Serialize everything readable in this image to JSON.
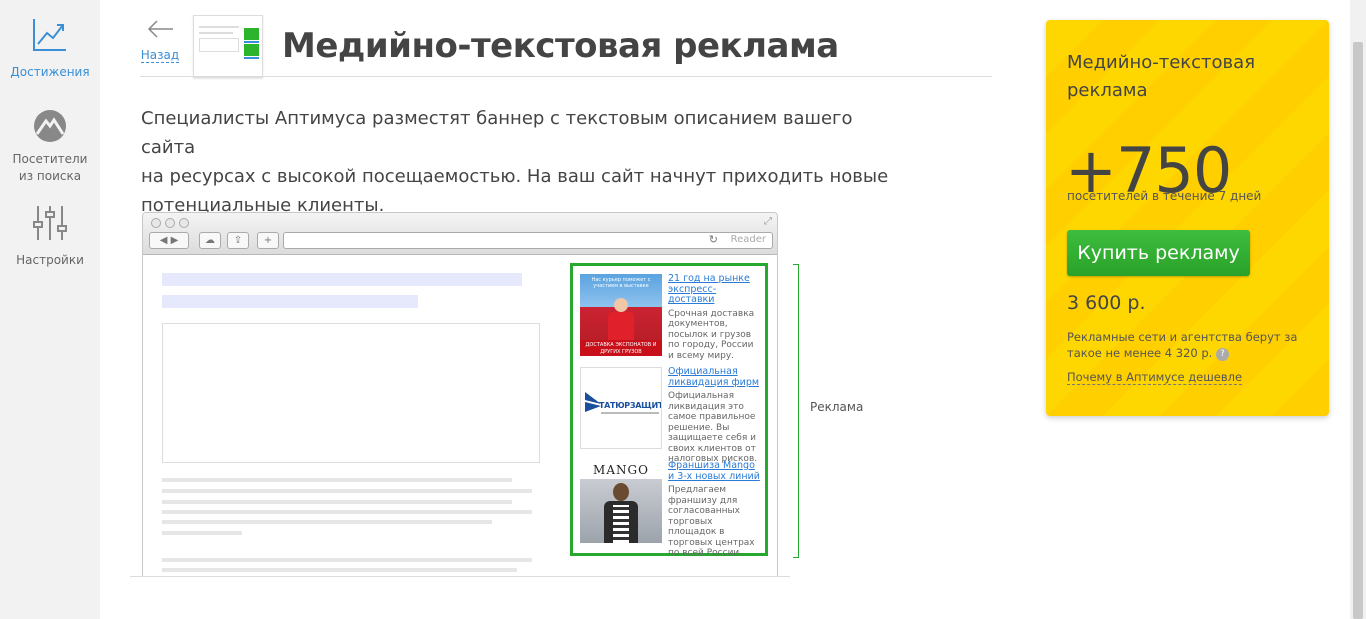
{
  "sidebar": {
    "items": [
      {
        "label": "Достижения",
        "icon": "chart-line-icon"
      },
      {
        "label_1": "Посетители",
        "label_2": "из поиска",
        "icon": "mountain-icon"
      },
      {
        "label": "Настройки",
        "icon": "sliders-icon"
      }
    ]
  },
  "header": {
    "back_label": "Назад",
    "title": "Медийно-текстовая реклама"
  },
  "description": {
    "line1": "Специалисты Аптимуса разместят баннер с текстовым описанием вашего сайта",
    "line2": "на ресурсах с высокой посещаемостью. На ваш сайт начнут приходить новые",
    "line3": "потенциальные клиенты."
  },
  "browser": {
    "reader_label": "Reader",
    "ads": [
      {
        "image_top": "Нас курьер поможет с участием в выставке",
        "image_bottom": "ДОСТАВКА ЭКСПОНАТОВ И ДРУГИХ ГРУЗОВ",
        "link": "21 год на рынке экспресс-доставки",
        "text": "Срочная доставка документов, посылок и грузов по городу, России и всему миру."
      },
      {
        "image_brand": "ТАТЮРЗАЩИТА",
        "link": "Официальная ликвидация фирм",
        "text": "Официальная ликвидация это самое правильное решение. Вы защищаете себя и своих клиентов от налоговых рисков."
      },
      {
        "image_brand": "MANGO",
        "link": "Франшиза Mango и 3-х новых линий",
        "text": "Предлагаем франшизу для согласованных торговых площадок в торговых центрах по всей России."
      }
    ],
    "ad_label": "Реклама"
  },
  "card": {
    "title_1": "Медийно-текстовая",
    "title_2": "реклама",
    "number": "+750",
    "subtitle": "посетителей в течение 7 дней",
    "buy_label": "Купить рекламу",
    "price": "3 600 р.",
    "note": "Рекламные сети и агентства берут за такое не менее 4 320 р.",
    "qmark": "?",
    "why_link": "Почему в Аптимусе дешевле",
    "accent_color": "#ffd700",
    "button_color": "#2aa52a"
  },
  "colors": {
    "link": "#3a8fd6",
    "ad_border": "#27a82e"
  }
}
